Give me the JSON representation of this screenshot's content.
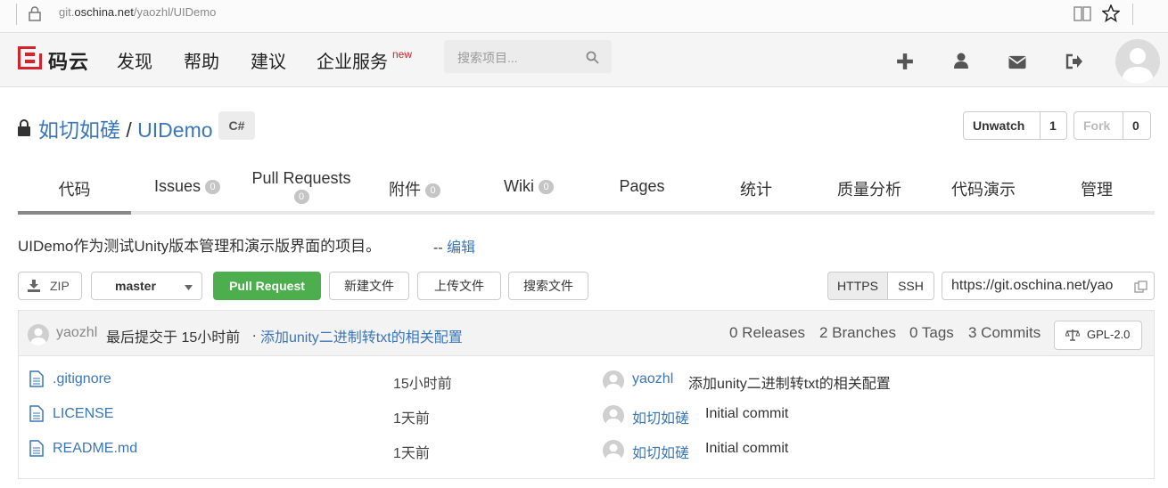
{
  "browser": {
    "url_prefix": "git.",
    "url_domain": "oschina.net",
    "url_path": "/yaozhl/UIDemo"
  },
  "header": {
    "logo_text": "码云",
    "nav": [
      "发现",
      "帮助",
      "建议",
      "企业服务"
    ],
    "new_badge": "new",
    "search_placeholder": "搜索项目..."
  },
  "repo": {
    "owner": "如切如磋",
    "separator": "/",
    "name": "UIDemo",
    "language": "C#",
    "unwatch_label": "Unwatch",
    "watch_count": "1",
    "fork_label": "Fork",
    "fork_count": "0",
    "description": "UIDemo作为测试Unity版本管理和演示版界面的项目。",
    "edit_prefix": "-- ",
    "edit_label": "编辑"
  },
  "tabs": [
    {
      "label": "代码"
    },
    {
      "label": "Issues",
      "count": "0"
    },
    {
      "label": "Pull Requests",
      "count": "0"
    },
    {
      "label": "附件",
      "count": "0"
    },
    {
      "label": "Wiki",
      "count": "0"
    },
    {
      "label": "Pages"
    },
    {
      "label": "统计"
    },
    {
      "label": "质量分析"
    },
    {
      "label": "代码演示"
    },
    {
      "label": "管理"
    }
  ],
  "toolbar": {
    "zip": "ZIP",
    "branch": "master",
    "pull_request": "Pull Request",
    "new_file": "新建文件",
    "upload_file": "上传文件",
    "search_file": "搜索文件",
    "https": "HTTPS",
    "ssh": "SSH",
    "clone_url": "https://git.oschina.net/yao"
  },
  "commit": {
    "author": "yaozhl",
    "text": "最后提交于 15小时前",
    "dot": ".",
    "message": "添加unity二进制转txt的相关配置",
    "releases": "0 Releases",
    "branches": "2 Branches",
    "tags": "0 Tags",
    "commits": "3 Commits",
    "license": "GPL-2.0"
  },
  "files": [
    {
      "name": ".gitignore",
      "time": "15小时前",
      "author": "yaozhl",
      "message": "添加unity二进制转txt的相关配置"
    },
    {
      "name": "LICENSE",
      "time": "1天前",
      "author": "如切如磋",
      "message": "Initial commit"
    },
    {
      "name": "README.md",
      "time": "1天前",
      "author": "如切如磋",
      "message": "Initial commit"
    }
  ],
  "colors": {
    "link": "#3a76b8",
    "brand_red": "#d4232b",
    "green": "#4cae4c"
  }
}
